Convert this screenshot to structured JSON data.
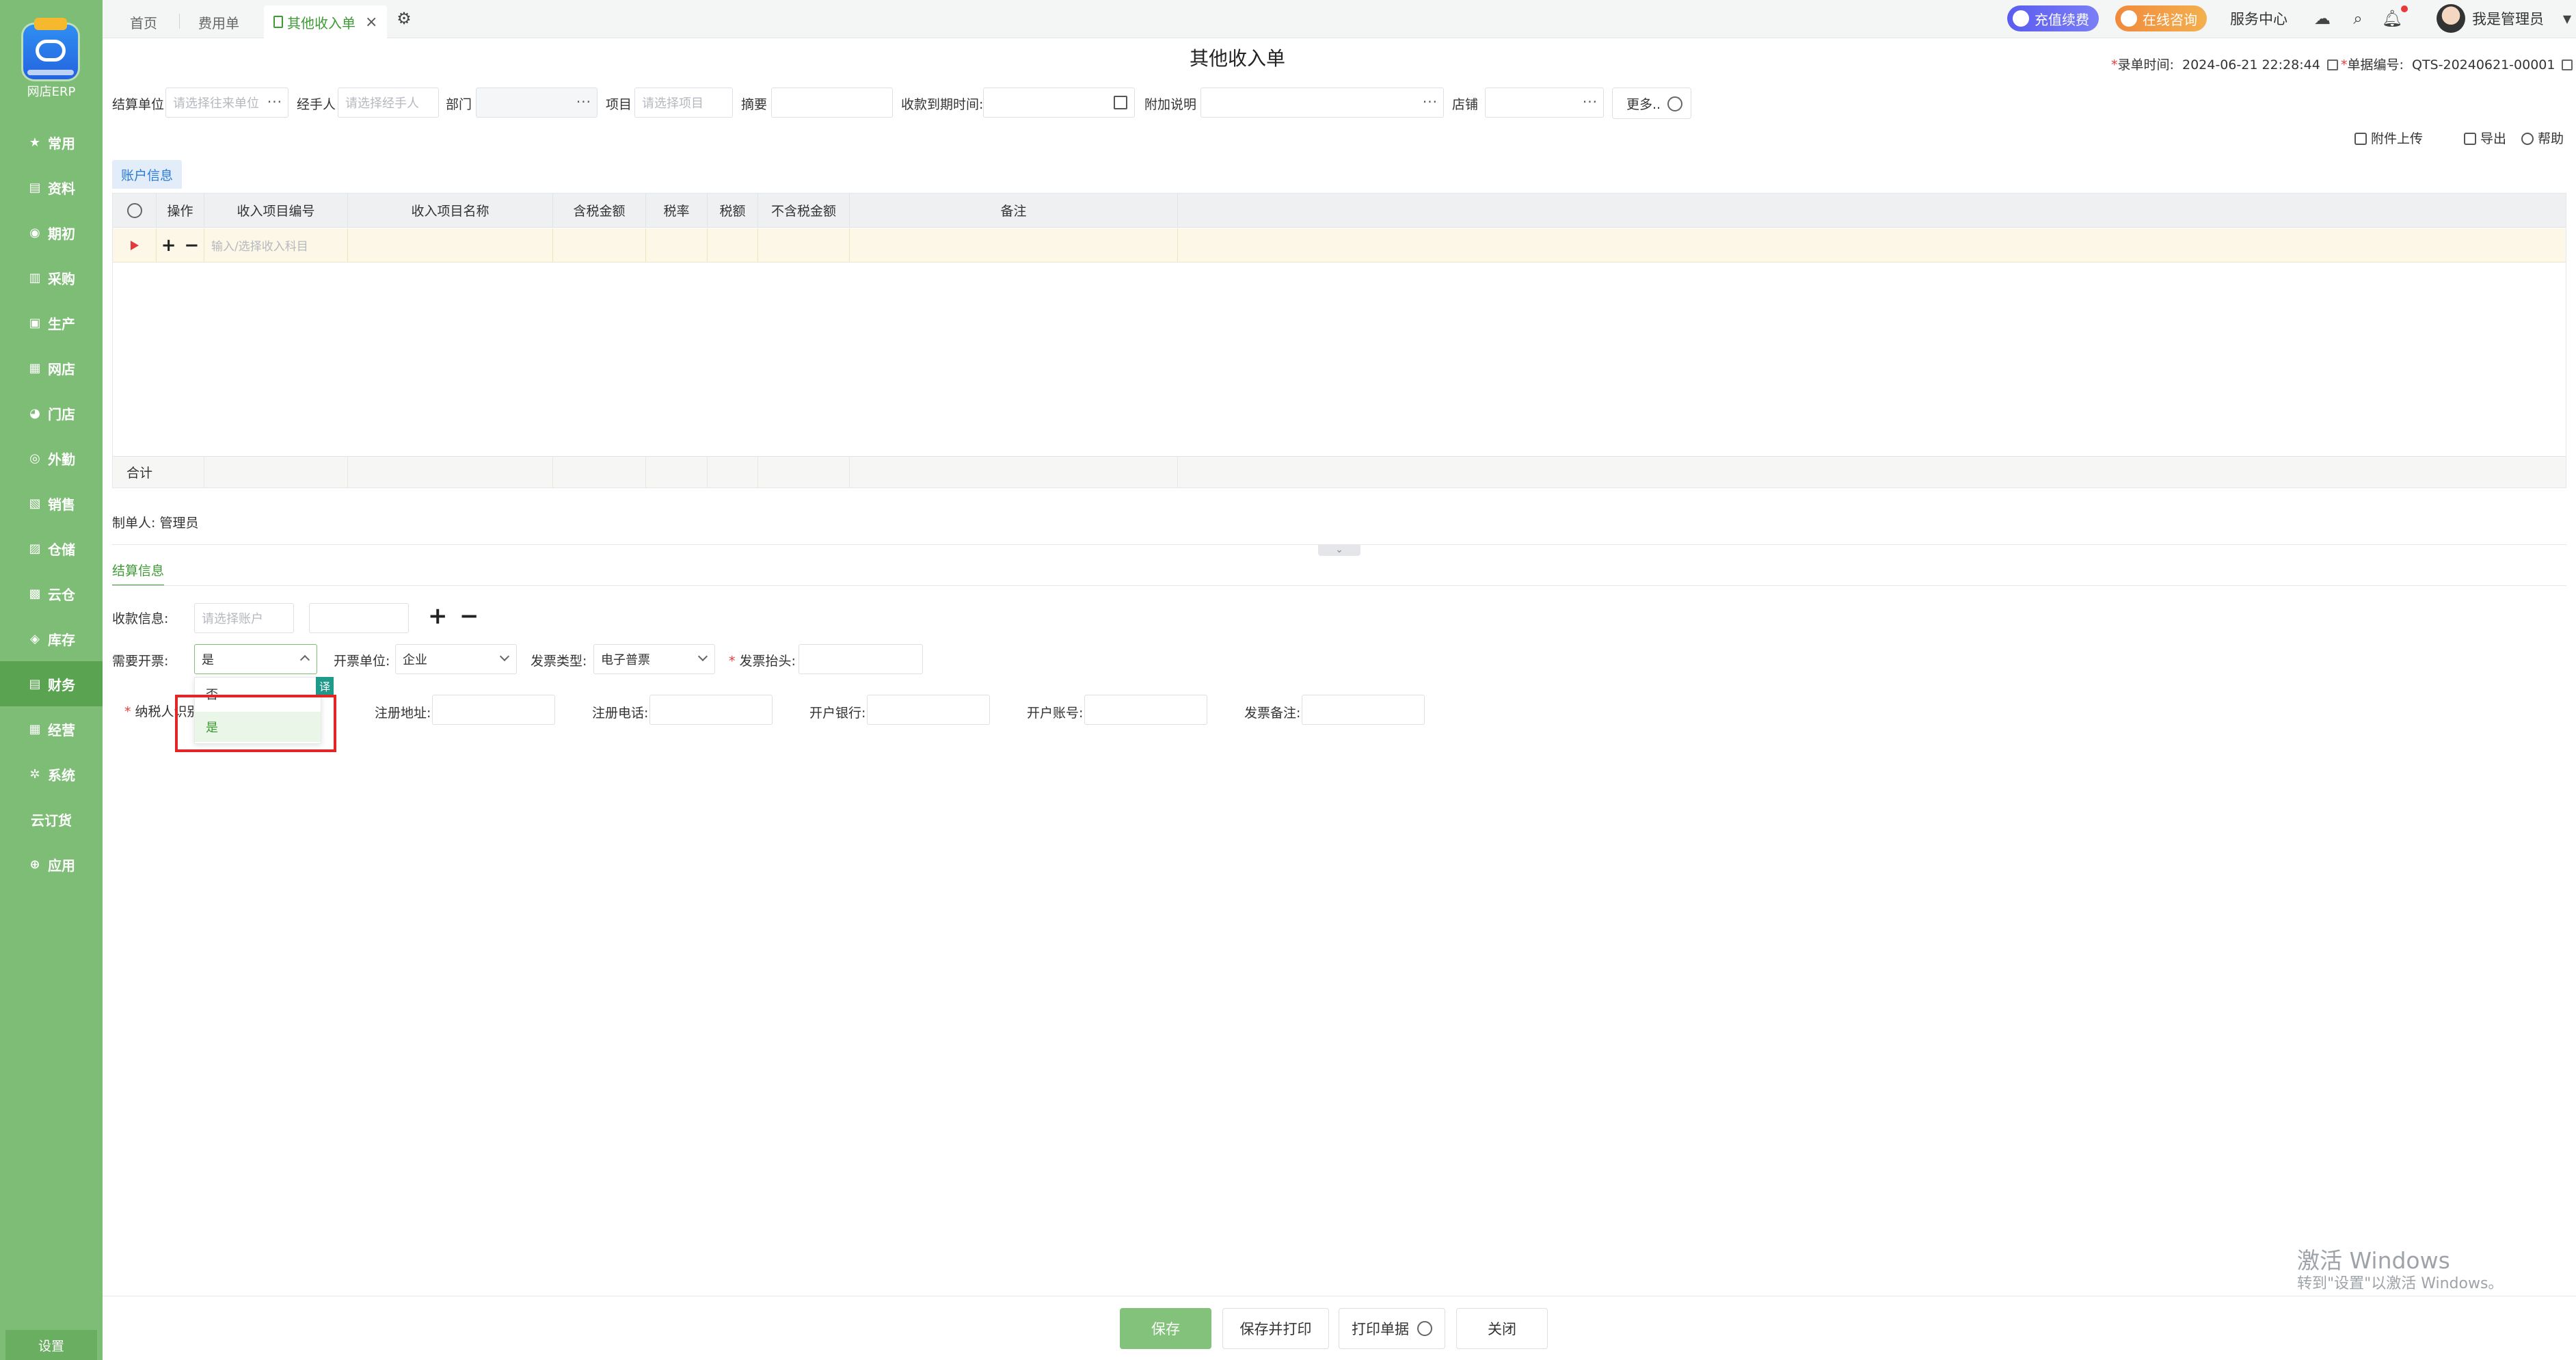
{
  "sidebar": {
    "logo_text": "网店ERP",
    "items": [
      {
        "label": "常用",
        "icon": "star-icon",
        "glyph": "★"
      },
      {
        "label": "资料",
        "icon": "document-icon",
        "glyph": "▤"
      },
      {
        "label": "期初",
        "icon": "circle-icon",
        "glyph": "◉"
      },
      {
        "label": "采购",
        "icon": "purchase-icon",
        "glyph": "▥"
      },
      {
        "label": "生产",
        "icon": "production-icon",
        "glyph": "▣"
      },
      {
        "label": "网店",
        "icon": "shop-icon",
        "glyph": "▦"
      },
      {
        "label": "门店",
        "icon": "store-icon",
        "glyph": "◕"
      },
      {
        "label": "外勤",
        "icon": "field-icon",
        "glyph": "◎"
      },
      {
        "label": "销售",
        "icon": "sales-icon",
        "glyph": "▧"
      },
      {
        "label": "仓储",
        "icon": "warehouse-icon",
        "glyph": "▨"
      },
      {
        "label": "云仓",
        "icon": "cloud-warehouse-icon",
        "glyph": "▩"
      },
      {
        "label": "库存",
        "icon": "inventory-icon",
        "glyph": "◈"
      },
      {
        "label": "财务",
        "icon": "finance-icon",
        "glyph": "▤"
      },
      {
        "label": "经营",
        "icon": "business-icon",
        "glyph": "▦"
      },
      {
        "label": "系统",
        "icon": "system-gear-icon",
        "glyph": "✲"
      },
      {
        "label": "云订货",
        "icon": "",
        "glyph": ""
      },
      {
        "label": "应用",
        "icon": "apps-icon",
        "glyph": "⊕"
      }
    ],
    "active_index": 12,
    "settings_label": "设置"
  },
  "topbar": {
    "tabs": [
      {
        "label": "首页"
      },
      {
        "label": "费用单"
      },
      {
        "label": "其他收入单"
      }
    ],
    "recharge_label": "充值续费",
    "consult_label": "在线咨询",
    "service_label": "服务中心",
    "user_label": "我是管理员"
  },
  "page": {
    "title": "其他收入单",
    "entry_time_label": "录单时间:",
    "entry_time": "2024-06-21 22:28:44",
    "doc_no_label": "单据编号:",
    "doc_no": "QTS-20240621-00001"
  },
  "header_fields": {
    "settle_unit_label": "结算单位",
    "settle_unit_placeholder": "请选择往来单位",
    "handler_label": "经手人",
    "handler_placeholder": "请选择经手人",
    "dept_label": "部门",
    "project_label": "项目",
    "project_placeholder": "请选择项目",
    "summary_label": "摘要",
    "due_time_label": "收款到期时间:",
    "extra_label": "附加说明",
    "store_label": "店铺",
    "more_label": "更多.."
  },
  "toolbar": {
    "upload_label": "附件上传",
    "export_label": "导出",
    "help_label": "帮助"
  },
  "account_tab": "账户信息",
  "grid": {
    "columns": [
      "操作",
      "收入项目编号",
      "收入项目名称",
      "含税金额",
      "税率",
      "税额",
      "不含税金额",
      "备注"
    ],
    "row_placeholder": "输入/选择收入科目",
    "total_label": "合计"
  },
  "maker": "制单人: 管理员",
  "settlement": {
    "tab_label": "结算信息",
    "payment_label": "收款信息:",
    "account_placeholder": "请选择账户",
    "need_invoice_label": "需要开票:",
    "need_invoice_value": "是",
    "invoice_unit_label": "开票单位:",
    "invoice_unit_value": "企业",
    "invoice_type_label": "发票类型:",
    "invoice_type_value": "电子普票",
    "invoice_title_label": "发票抬头:",
    "taxpayer_id_label": "纳税人识别",
    "reg_address_label": "注册地址:",
    "reg_phone_label": "注册电话:",
    "bank_label": "开户银行:",
    "bank_account_label": "开户账号:",
    "invoice_remark_label": "发票备注:"
  },
  "dropdown": {
    "options": [
      "否",
      "是"
    ],
    "selected_index": 1,
    "tag": "译"
  },
  "footer": {
    "save_label": "保存",
    "save_print_label": "保存并打印",
    "print_label": "打印单据",
    "close_label": "关闭"
  },
  "watermark": {
    "line1": "激活 Windows",
    "line2": "转到\"设置\"以激活 Windows。"
  },
  "colors": {
    "sidebar": "#7dbd75",
    "accent": "#3d9a34",
    "primary_button": "#82c27a",
    "highlight": "#e42525"
  }
}
